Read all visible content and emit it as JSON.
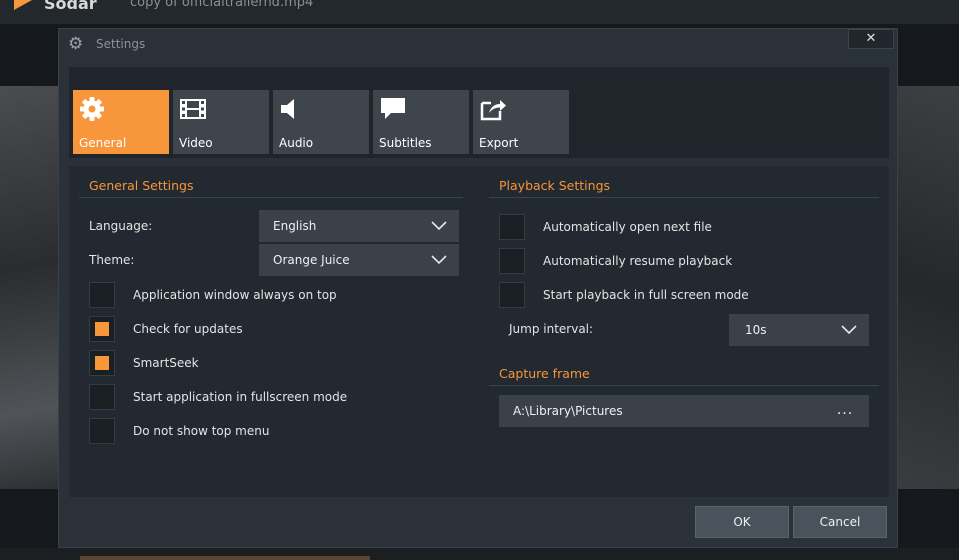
{
  "background_app": {
    "app_name": "Sodar",
    "document_title": "copy of officialtrailerhd.mp4"
  },
  "dialog": {
    "title": "Settings",
    "close_label": "✕"
  },
  "tabs": [
    {
      "label": "General",
      "icon": "gear-icon",
      "active": true
    },
    {
      "label": "Video",
      "icon": "film-icon",
      "active": false
    },
    {
      "label": "Audio",
      "icon": "speaker-icon",
      "active": false
    },
    {
      "label": "Subtitles",
      "icon": "speech-bubble-icon",
      "active": false
    },
    {
      "label": "Export",
      "icon": "export-icon",
      "active": false
    }
  ],
  "general": {
    "title": "General Settings",
    "language": {
      "label": "Language:",
      "value": "English"
    },
    "theme": {
      "label": "Theme:",
      "value": "Orange Juice"
    },
    "options": [
      {
        "label": "Application window always on top",
        "checked": false
      },
      {
        "label": "Check for updates",
        "checked": true
      },
      {
        "label": "SmartSeek",
        "checked": true
      },
      {
        "label": "Start application in fullscreen mode",
        "checked": false
      },
      {
        "label": "Do not show top menu",
        "checked": false
      }
    ]
  },
  "playback": {
    "title": "Playback Settings",
    "options": [
      {
        "label": "Automatically open next file",
        "checked": false
      },
      {
        "label": "Automatically resume playback",
        "checked": false
      },
      {
        "label": "Start playback in full screen mode",
        "checked": false
      }
    ],
    "jump_interval": {
      "label": "Jump interval:",
      "value": "10s"
    }
  },
  "capture": {
    "title": "Capture frame",
    "path": "A:\\Library\\Pictures",
    "browse_label": "..."
  },
  "buttons": {
    "ok": "OK",
    "cancel": "Cancel"
  },
  "colors": {
    "accent": "#f7963a",
    "dialog_bg": "#2a3138",
    "panel_bg": "#222930",
    "control_bg": "#3a4148"
  }
}
